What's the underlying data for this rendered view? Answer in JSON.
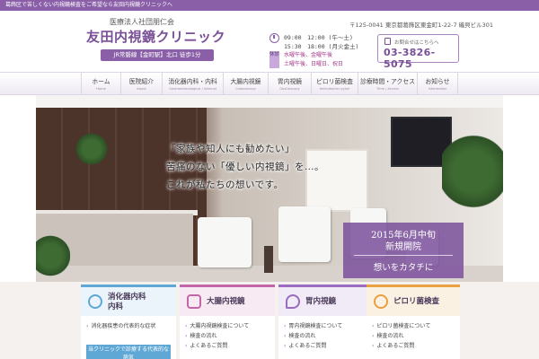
{
  "topbar": {
    "text": "葛飾区で苦しくない内視鏡検査をご希望なら友田内視鏡クリニックへ"
  },
  "header": {
    "org": "医療法人社団朋仁会",
    "logo": "友田内視鏡クリニック",
    "access": "JR常磐線【金町駅】北口 徒歩1分",
    "address": "〒125-0041 東京都葛飾区東金町1-22-7 磯貝ビル301",
    "hours_am": "09:00　12:00 (午～土)",
    "hours_pm": "15:30　18:00 (月火金土)",
    "closed_tag": "休診",
    "closed_line1": "水曜午後、金曜午後",
    "closed_line2": "土曜午後、日曜日、祝日",
    "phone_lead": "お問合せはこちらへ",
    "phone": "03-3826-5075",
    "colors": {
      "accent": "#8a5fa8",
      "accent_dark": "#7a4f98",
      "closed": "#a4388a"
    },
    "icons": {
      "hours": "clock-icon",
      "phone": "phone-icon"
    }
  },
  "nav": {
    "items": [
      {
        "label": "ホーム",
        "sub": "Home"
      },
      {
        "label": "医院紹介",
        "sub": "About"
      },
      {
        "label": "消化器内科・内科",
        "sub": "Gastroenterological / Internal"
      },
      {
        "label": "大腸内視鏡",
        "sub": "Colonoscopy"
      },
      {
        "label": "胃内視鏡",
        "sub": "Gastroscopy"
      },
      {
        "label": "ピロリ菌検査",
        "sub": "Helicobacter pylori"
      },
      {
        "label": "診療時間・アクセス",
        "sub": "Time / Access"
      },
      {
        "label": "お知らせ",
        "sub": "Information"
      }
    ]
  },
  "hero": {
    "line1": "「家族や知人にも勧めたい」",
    "line2": "苦痛のない「優しい内視鏡」を…。",
    "line3": "これが私たちの想いです。",
    "open_date": "2015年6月中旬",
    "open_text": "新規開院",
    "tagline": "想いをカタチに"
  },
  "cards": [
    {
      "title_line1": "消化器内科",
      "title_line2": "内科",
      "icon": "stethoscope-icon",
      "color": "#5fa8d6",
      "links": [
        "消化器疾患の代表的な症状"
      ],
      "note": "当クリニックで診療する代表的な病気"
    },
    {
      "title_line1": "大腸内視鏡",
      "title_line2": "",
      "icon": "colon-icon",
      "color": "#c266a8",
      "links": [
        "大腸内視鏡検査について",
        "検査の流れ",
        "よくあるご質問"
      ]
    },
    {
      "title_line1": "胃内視鏡",
      "title_line2": "",
      "icon": "stomach-icon",
      "color": "#9a6cc0",
      "links": [
        "胃内視鏡検査について",
        "検査の流れ",
        "よくあるご質問"
      ]
    },
    {
      "title_line1": "ピロリ菌検査",
      "title_line2": "",
      "icon": "pylori-icon",
      "color": "#e8a040",
      "links": [
        "ピロリ菌検査について",
        "検査の流れ",
        "よくあるご質問"
      ]
    }
  ]
}
